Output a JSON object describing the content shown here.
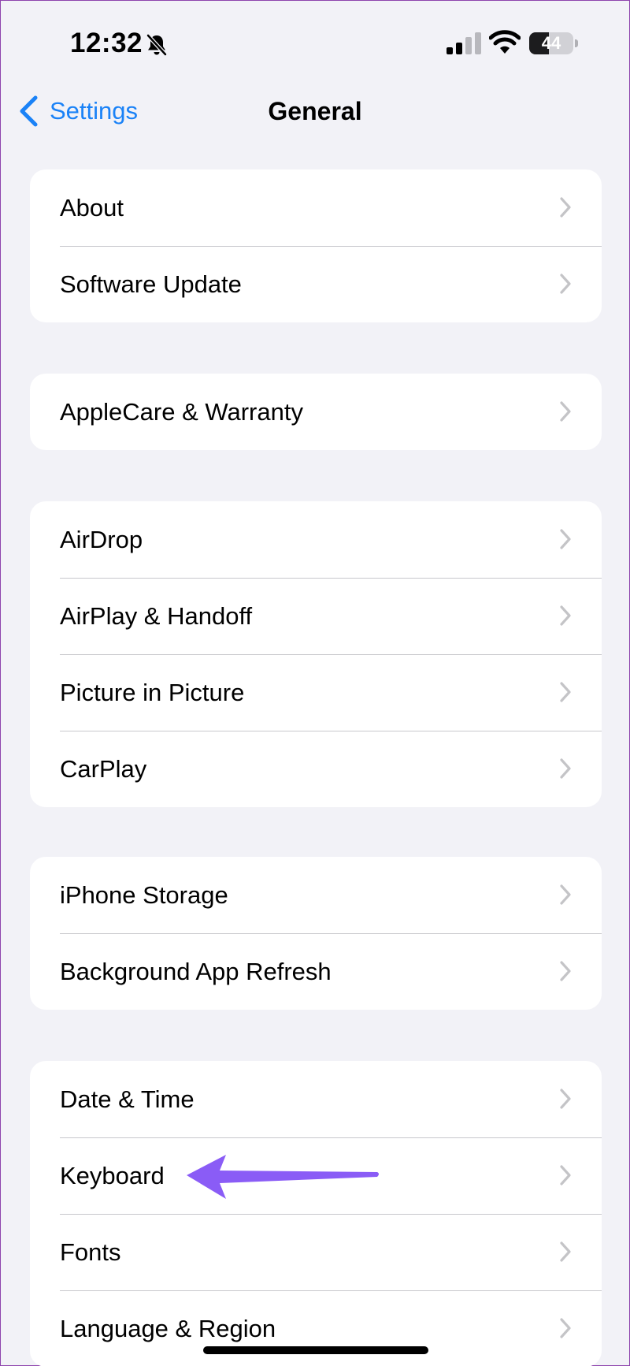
{
  "status_bar": {
    "time": "12:32",
    "battery_level": 44,
    "battery_label": "44"
  },
  "nav": {
    "back_label": "Settings",
    "title": "General"
  },
  "groups": [
    {
      "items": [
        {
          "label": "About"
        },
        {
          "label": "Software Update"
        }
      ]
    },
    {
      "items": [
        {
          "label": "AppleCare & Warranty"
        }
      ]
    },
    {
      "items": [
        {
          "label": "AirDrop"
        },
        {
          "label": "AirPlay & Handoff"
        },
        {
          "label": "Picture in Picture"
        },
        {
          "label": "CarPlay"
        }
      ]
    },
    {
      "items": [
        {
          "label": "iPhone Storage"
        },
        {
          "label": "Background App Refresh"
        }
      ]
    },
    {
      "items": [
        {
          "label": "Date & Time"
        },
        {
          "label": "Keyboard"
        },
        {
          "label": "Fonts"
        },
        {
          "label": "Language & Region"
        }
      ]
    }
  ],
  "colors": {
    "accent": "#1a82f7",
    "background": "#f2f2f7",
    "annotation": "#8a5cf6"
  }
}
